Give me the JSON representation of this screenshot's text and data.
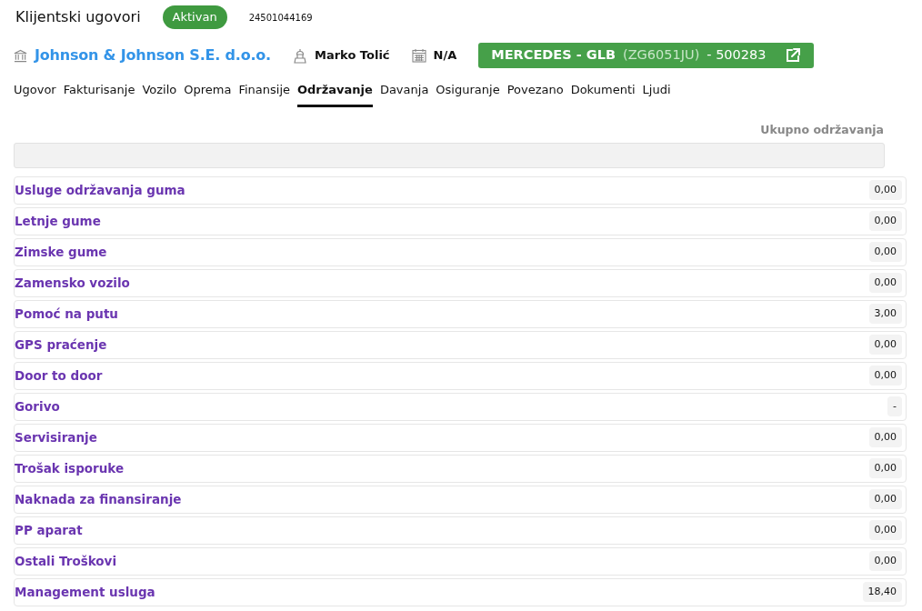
{
  "header": {
    "title": "Klijentski ugovori",
    "status": "Aktivan",
    "number": "24501044169"
  },
  "info": {
    "client": "Johnson & Johnson S.E. d.o.o.",
    "person": "Marko Tolić",
    "date": "N/A",
    "vehicle": {
      "name": "MERCEDES - GLB",
      "plate": "(ZG6051JU)",
      "code": "- 500283"
    }
  },
  "tabs": [
    {
      "label": "Ugovor",
      "selected": false
    },
    {
      "label": "Fakturisanje",
      "selected": false
    },
    {
      "label": "Vozilo",
      "selected": false
    },
    {
      "label": "Oprema",
      "selected": false
    },
    {
      "label": "Finansije",
      "selected": false
    },
    {
      "label": "Održavanje",
      "selected": true
    },
    {
      "label": "Davanja",
      "selected": false
    },
    {
      "label": "Osiguranje",
      "selected": false
    },
    {
      "label": "Povezano",
      "selected": false
    },
    {
      "label": "Dokumenti",
      "selected": false
    },
    {
      "label": "Ljudi",
      "selected": false
    }
  ],
  "total": {
    "label": "Ukupno održavanja"
  },
  "rows": [
    {
      "label": "Usluge održavanja guma",
      "value": "0,00"
    },
    {
      "label": "Letnje gume",
      "value": "0,00"
    },
    {
      "label": "Zimske gume",
      "value": "0,00"
    },
    {
      "label": "Zamensko vozilo",
      "value": "0,00"
    },
    {
      "label": "Pomoć na putu",
      "value": "3,00"
    },
    {
      "label": "GPS praćenje",
      "value": "0,00"
    },
    {
      "label": "Door to door",
      "value": "0,00"
    },
    {
      "label": "Gorivo",
      "value": "-"
    },
    {
      "label": "Servisiranje",
      "value": "0,00"
    },
    {
      "label": "Trošak isporuke",
      "value": "0,00"
    },
    {
      "label": "Naknada za finansiranje",
      "value": "0,00"
    },
    {
      "label": "PP aparat",
      "value": "0,00"
    },
    {
      "label": "Ostali Troškovi",
      "value": "0,00"
    },
    {
      "label": "Management usluga",
      "value": "18,40"
    }
  ]
}
